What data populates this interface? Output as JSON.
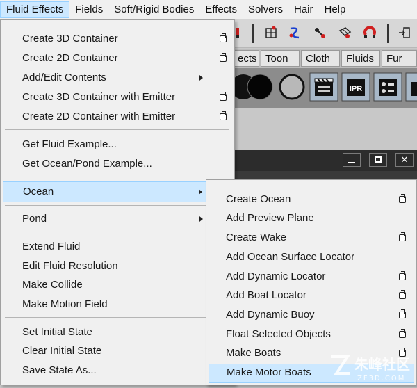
{
  "menubar": {
    "items": [
      "Fluid Effects",
      "Fields",
      "Soft/Rigid Bodies",
      "Effects",
      "Solvers",
      "Hair",
      "Help"
    ]
  },
  "shelf_tabs": [
    "ects",
    "Toon",
    "Cloth",
    "Fluids",
    "Fur"
  ],
  "fluid_menu": {
    "items": [
      {
        "label": "Create 3D Container",
        "option_box": true
      },
      {
        "label": "Create 2D Container",
        "option_box": true
      },
      {
        "label": "Add/Edit Contents",
        "submenu": true
      },
      {
        "label": "Create 3D Container with Emitter",
        "option_box": true
      },
      {
        "label": "Create 2D Container with Emitter",
        "option_box": true
      },
      {
        "label": "Get Fluid Example..."
      },
      {
        "label": "Get Ocean/Pond Example..."
      },
      {
        "label": "Ocean",
        "submenu": true,
        "highlighted": true
      },
      {
        "label": "Pond",
        "submenu": true
      },
      {
        "label": "Extend Fluid"
      },
      {
        "label": "Edit Fluid Resolution"
      },
      {
        "label": "Make Collide"
      },
      {
        "label": "Make Motion Field"
      },
      {
        "label": "Set Initial State"
      },
      {
        "label": "Clear Initial State"
      },
      {
        "label": "Save State As..."
      }
    ]
  },
  "ocean_submenu": {
    "items": [
      {
        "label": "Create Ocean",
        "option_box": true
      },
      {
        "label": "Add Preview Plane"
      },
      {
        "label": "Create Wake",
        "option_box": true
      },
      {
        "label": "Add Ocean Surface Locator"
      },
      {
        "label": "Add Dynamic Locator",
        "option_box": true
      },
      {
        "label": "Add Boat Locator",
        "option_box": true
      },
      {
        "label": "Add Dynamic Buoy",
        "option_box": true
      },
      {
        "label": "Float Selected Objects",
        "option_box": true
      },
      {
        "label": "Make Boats",
        "option_box": true
      },
      {
        "label": "Make Motor Boats",
        "highlighted": true
      }
    ]
  },
  "watermark": {
    "text": "朱峰社区",
    "sub": "ZF3D.COM"
  },
  "colors": {
    "highlight": "#cce8ff",
    "highlight_border": "#99d1ff",
    "menu_bg": "#f0f0f0"
  }
}
